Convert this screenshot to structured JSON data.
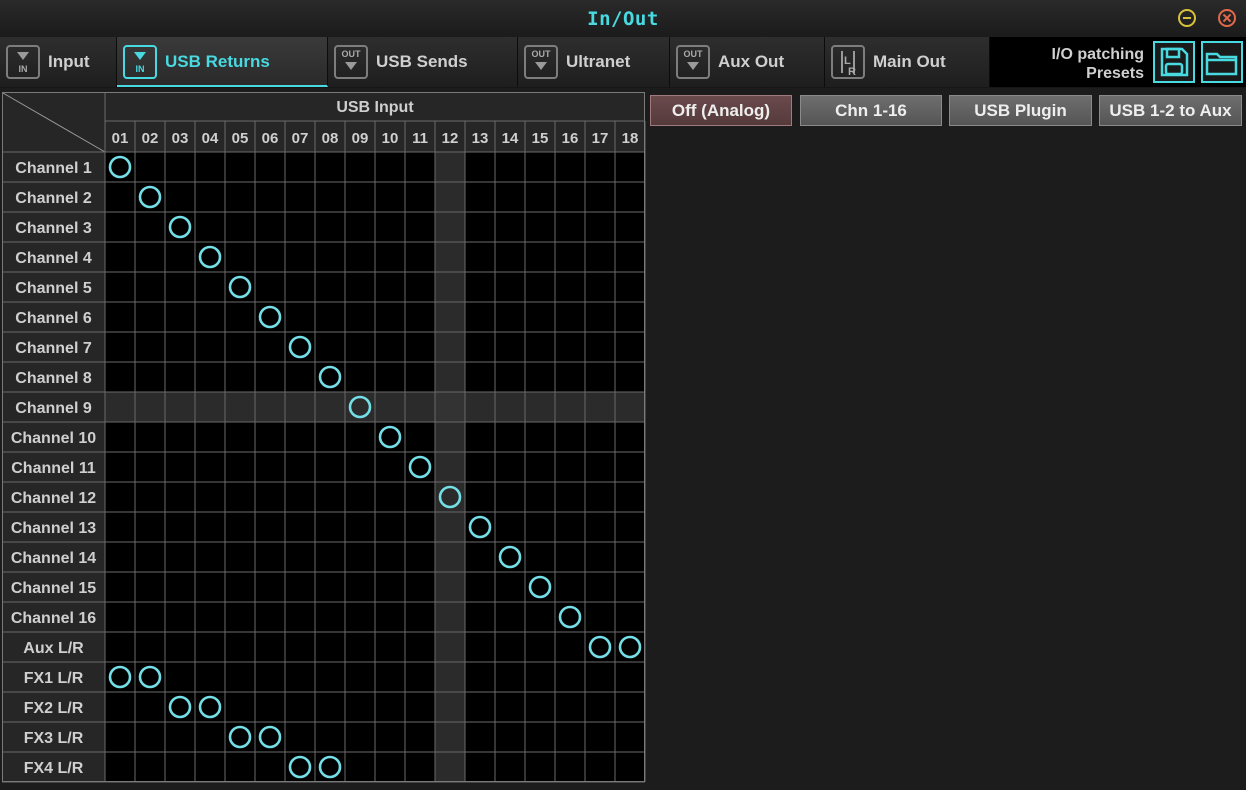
{
  "window": {
    "title": "In/Out",
    "minimize_icon": "minimize-icon",
    "close_icon": "close-icon"
  },
  "tabs": [
    {
      "label": "Input",
      "icon_top": "",
      "icon_bottom": "IN",
      "icon": "input-arrow-icon",
      "active": false
    },
    {
      "label": "USB Returns",
      "icon_top": "",
      "icon_bottom": "IN",
      "icon": "input-arrow-icon",
      "active": true
    },
    {
      "label": "USB Sends",
      "icon_top": "OUT",
      "icon_bottom": "",
      "icon": "output-arrow-icon",
      "active": false
    },
    {
      "label": "Ultranet",
      "icon_top": "OUT",
      "icon_bottom": "",
      "icon": "output-arrow-icon",
      "active": false
    },
    {
      "label": "Aux Out",
      "icon_top": "OUT",
      "icon_bottom": "",
      "icon": "output-arrow-icon",
      "active": false
    },
    {
      "label": "Main Out",
      "icon_top": "L",
      "icon_bottom": "R",
      "icon": "main-lr-icon",
      "active": false
    }
  ],
  "presets": {
    "label_line1": "I/O patching",
    "label_line2": "Presets",
    "save_icon": "save-icon",
    "open_icon": "folder-icon"
  },
  "matrix": {
    "header": "USB Input",
    "columns": [
      "01",
      "02",
      "03",
      "04",
      "05",
      "06",
      "07",
      "08",
      "09",
      "10",
      "11",
      "12",
      "13",
      "14",
      "15",
      "16",
      "17",
      "18"
    ],
    "rows": [
      "Channel 1",
      "Channel 2",
      "Channel 3",
      "Channel 4",
      "Channel 5",
      "Channel 6",
      "Channel 7",
      "Channel 8",
      "Channel 9",
      "Channel 10",
      "Channel 11",
      "Channel 12",
      "Channel 13",
      "Channel 14",
      "Channel 15",
      "Channel 16",
      "Aux L/R",
      "FX1 L/R",
      "FX2 L/R",
      "FX3 L/R",
      "FX4 L/R"
    ],
    "highlight_row": 8,
    "highlight_col": 11,
    "patches": [
      [
        0,
        0
      ],
      [
        1,
        1
      ],
      [
        2,
        2
      ],
      [
        3,
        3
      ],
      [
        4,
        4
      ],
      [
        5,
        5
      ],
      [
        6,
        6
      ],
      [
        7,
        7
      ],
      [
        8,
        8
      ],
      [
        9,
        9
      ],
      [
        10,
        10
      ],
      [
        11,
        11
      ],
      [
        12,
        12
      ],
      [
        13,
        13
      ],
      [
        14,
        14
      ],
      [
        15,
        15
      ],
      [
        16,
        16
      ],
      [
        16,
        17
      ],
      [
        17,
        0
      ],
      [
        17,
        1
      ],
      [
        18,
        2
      ],
      [
        18,
        3
      ],
      [
        19,
        4
      ],
      [
        19,
        5
      ],
      [
        20,
        6
      ],
      [
        20,
        7
      ]
    ],
    "accent": "#74dfe7"
  },
  "modes": [
    {
      "label": "Off (Analog)",
      "selected": true
    },
    {
      "label": "Chn 1-16",
      "selected": false
    },
    {
      "label": "USB Plugin",
      "selected": false
    },
    {
      "label": "USB 1-2 to Aux",
      "selected": false
    }
  ]
}
